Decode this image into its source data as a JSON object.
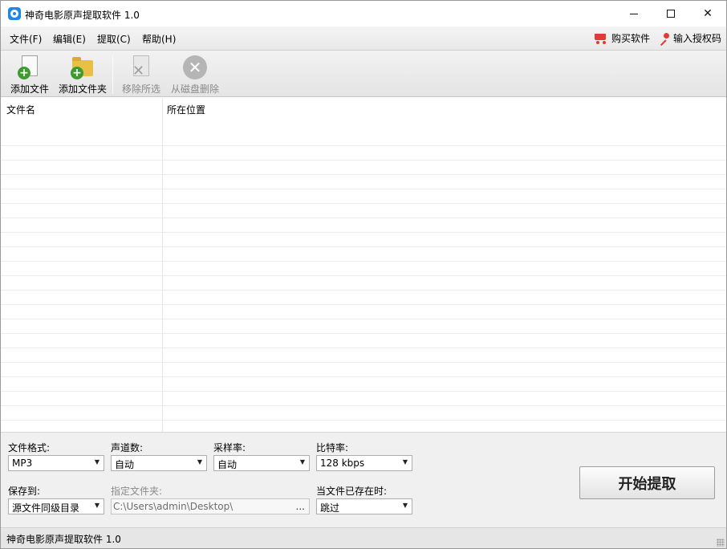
{
  "window": {
    "title": "神奇电影原声提取软件 1.0"
  },
  "menu": {
    "items": [
      {
        "label": "文件(F)"
      },
      {
        "label": "编辑(E)"
      },
      {
        "label": "提取(C)"
      },
      {
        "label": "帮助(H)"
      }
    ],
    "buy_label": "购买软件",
    "license_label": "输入授权码"
  },
  "toolbar": {
    "add_file": "添加文件",
    "add_folder": "添加文件夹",
    "remove_selected": "移除所选",
    "delete_from_disk": "从磁盘删除"
  },
  "file_list": {
    "columns": [
      "文件名",
      "所在位置"
    ],
    "rows": []
  },
  "settings": {
    "format_label": "文件格式:",
    "format_value": "MP3",
    "channels_label": "声道数:",
    "channels_value": "自动",
    "samplerate_label": "采样率:",
    "samplerate_value": "自动",
    "bitrate_label": "比特率:",
    "bitrate_value": "128 kbps",
    "saveto_label": "保存到:",
    "saveto_value": "源文件同级目录",
    "folder_label": "指定文件夹:",
    "folder_value": "C:\\Users\\admin\\Desktop\\",
    "browse_label": "...",
    "exists_label": "当文件已存在时:",
    "exists_value": "跳过",
    "start_button": "开始提取"
  },
  "status": {
    "text": "神奇电影原声提取软件 1.0"
  },
  "colors": {
    "accent_red": "#e53935",
    "app_icon_blue": "#1e88e5",
    "add_green": "#3e9b2f"
  }
}
